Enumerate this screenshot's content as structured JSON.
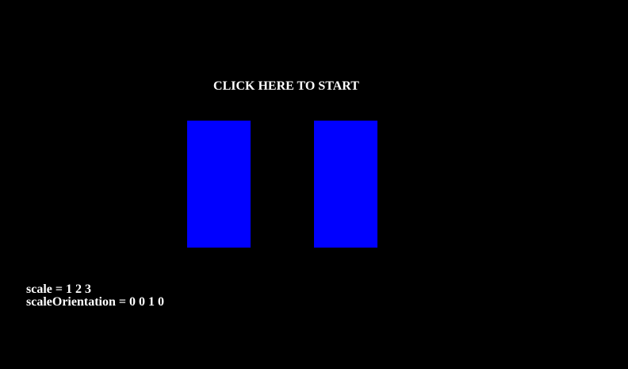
{
  "scene": {
    "background_color": "#000000",
    "start_prompt": "CLICK HERE TO START",
    "box_color": "#0000ff",
    "text_color": "#ffffff"
  },
  "info": {
    "scale_line": "scale = 1 2 3",
    "orientation_line": "scaleOrientation = 0 0 1 0"
  }
}
